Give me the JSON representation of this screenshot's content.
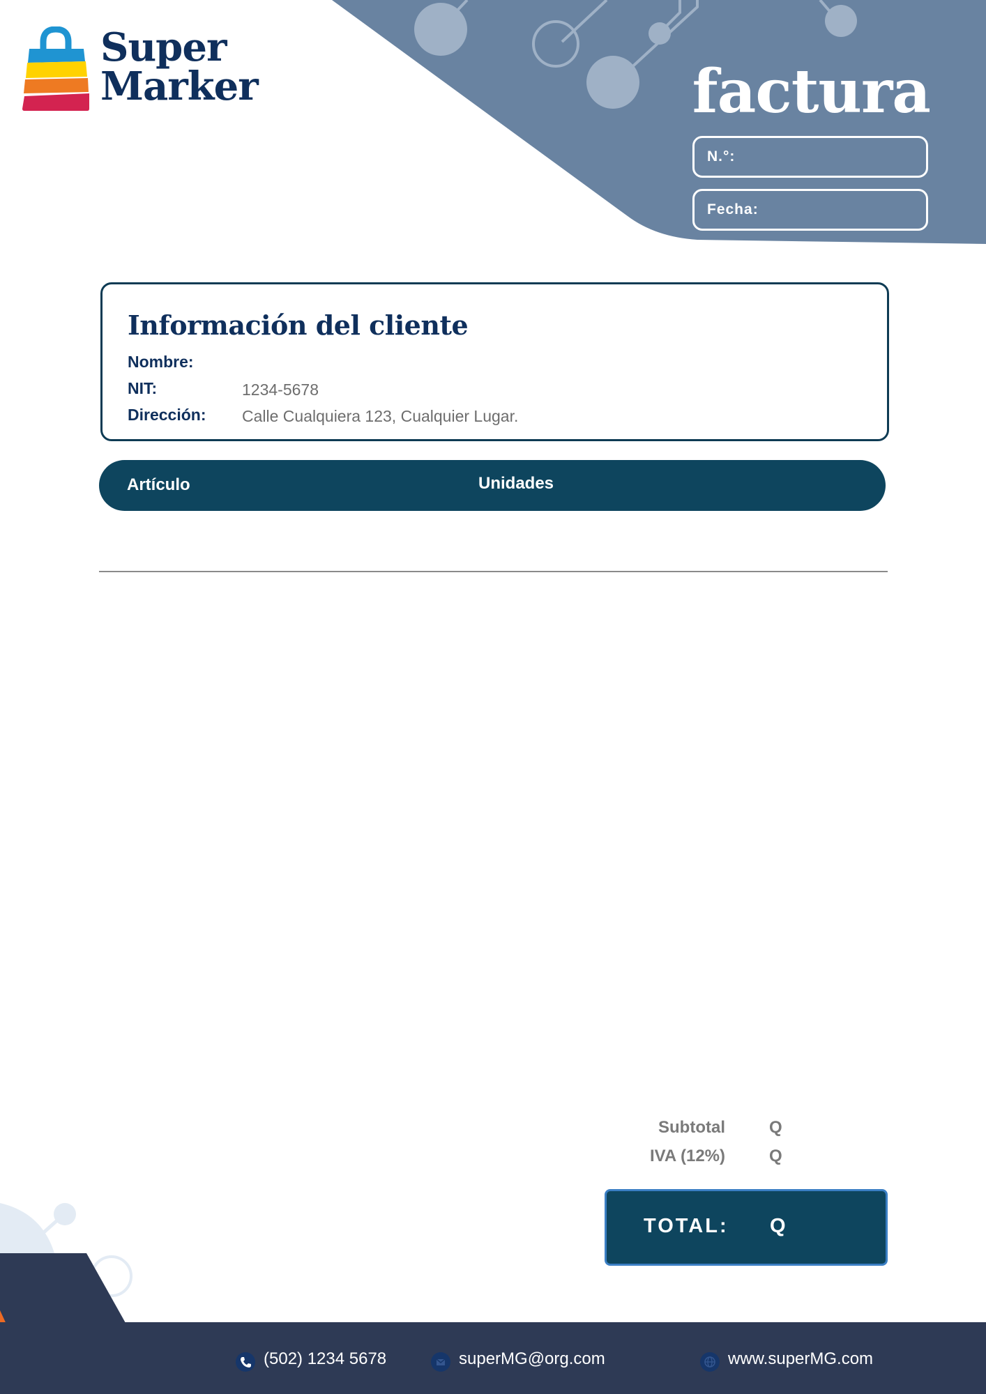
{
  "brand": {
    "name_line1": "Super",
    "name_line2": "Marker",
    "colors": {
      "navy": "#0f2f5c",
      "teal": "#0e455e",
      "header_blue": "#6983a1",
      "footer": "#2e3a55",
      "bag_blue": "#1f94d2",
      "bag_yellow": "#ffd200",
      "bag_orange": "#ee7a22",
      "bag_red": "#d32350",
      "accent_orange": "#ec6a24"
    }
  },
  "invoice": {
    "title": "factura",
    "number_label": "N.°:",
    "date_label": "Fecha:"
  },
  "client": {
    "title": "Información del cliente",
    "name_label": "Nombre:",
    "name_value": "",
    "nit_label": "NIT:",
    "nit_value": "1234-5678",
    "address_label": "Dirección:",
    "address_value": "Calle Cualquiera 123, Cualquier Lugar."
  },
  "table": {
    "columns": [
      "Artículo",
      "Unidades"
    ],
    "rows": []
  },
  "totals": {
    "subtotal_label": "Subtotal",
    "subtotal_value": "Q",
    "tax_label": "IVA (12%)",
    "tax_value": "Q",
    "total_label": "TOTAL:",
    "total_value": "Q"
  },
  "footer": {
    "phone": "(502) 1234 5678",
    "phone_icon": "phone-icon",
    "email": "superMG@org.com",
    "email_icon": "email-icon",
    "website": "www.superMG.com",
    "website_icon": "globe-icon"
  }
}
